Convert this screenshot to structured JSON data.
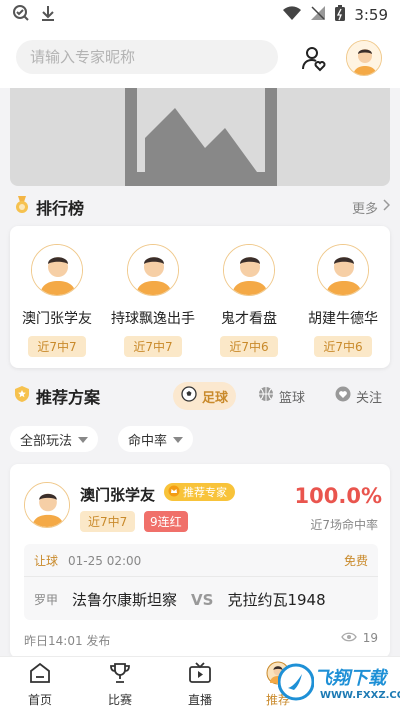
{
  "status_bar": {
    "time": "3:59"
  },
  "search": {
    "placeholder": "请输入专家昵称"
  },
  "ranking": {
    "title": "排行榜",
    "more_label": "更多",
    "experts": [
      {
        "name": "澳门张学友",
        "record": "近7中7"
      },
      {
        "name": "持球飘逸出手",
        "record": "近7中7"
      },
      {
        "name": "鬼才看盘",
        "record": "近7中6"
      },
      {
        "name": "胡建牛德华",
        "record": "近7中6"
      }
    ]
  },
  "recommend": {
    "title": "推荐方案",
    "tabs": [
      {
        "label": "足球",
        "active": true
      },
      {
        "label": "篮球",
        "active": false
      },
      {
        "label": "关注",
        "active": false
      }
    ],
    "filters": [
      "全部玩法",
      "命中率"
    ]
  },
  "scheme": {
    "expert_name": "澳门张学友",
    "expert_tag": "推荐专家",
    "record_tag": "近7中7",
    "streak_tag": "9连红",
    "hit_rate": "100.0%",
    "hit_label": "近7场命中率",
    "play_type": "让球",
    "match_time": "01-25 02:00",
    "price": "免费",
    "league": "罗甲",
    "home_team": "法鲁尔康斯坦察",
    "vs": "VS",
    "away_team": "克拉约瓦1948",
    "published": "昨日14:01 发布",
    "views": "19"
  },
  "bottom_nav": {
    "items": [
      "首页",
      "比赛",
      "直播",
      "推荐"
    ]
  },
  "watermark": {
    "text": "飞翔下载",
    "url": "WWW.FXXZ.COM"
  },
  "colors": {
    "accent": "#c98a2b",
    "accent_bg": "#fbe8c8",
    "red": "#e9554e"
  }
}
